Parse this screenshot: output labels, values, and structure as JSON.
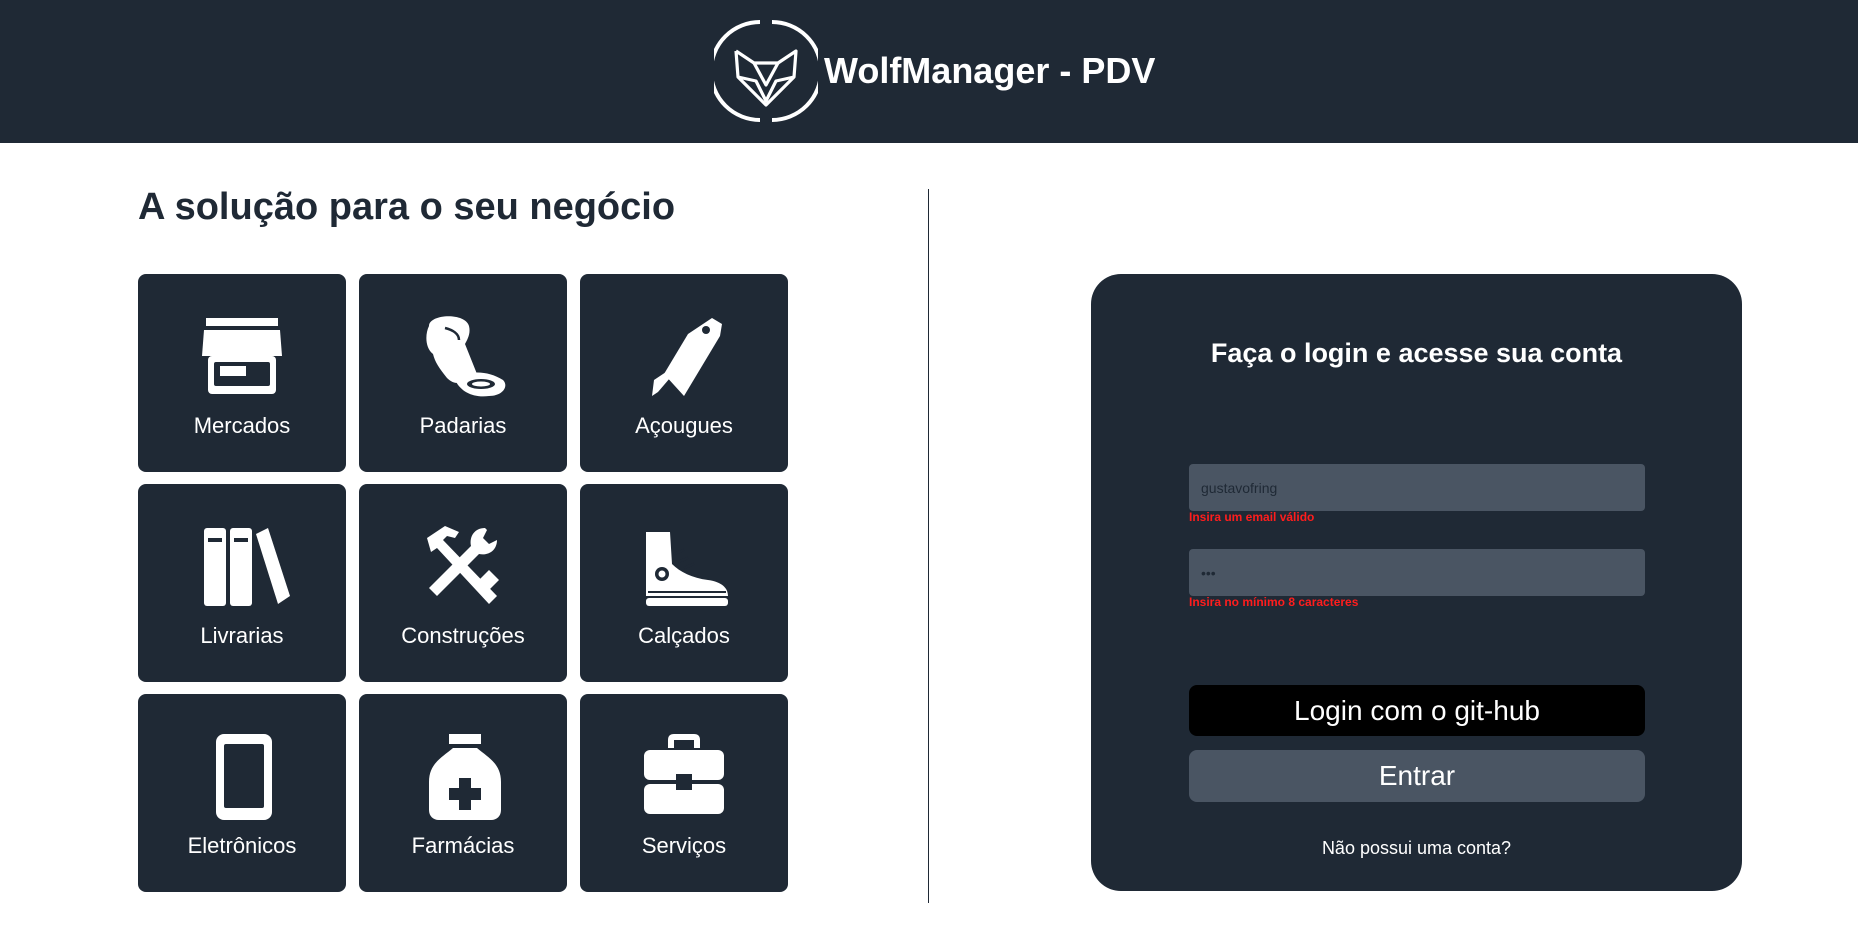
{
  "header": {
    "brand_title": "WolfManager - PDV",
    "logo_icon": "wolf-logo-icon"
  },
  "main": {
    "headline": "A solução para o seu negócio",
    "categories": [
      {
        "label": "Mercados",
        "icon": "store-icon"
      },
      {
        "label": "Padarias",
        "icon": "bread-icon"
      },
      {
        "label": "Açougues",
        "icon": "cleaver-icon"
      },
      {
        "label": "Livrarias",
        "icon": "books-icon"
      },
      {
        "label": "Construções",
        "icon": "tools-icon"
      },
      {
        "label": "Calçados",
        "icon": "sneaker-icon"
      },
      {
        "label": "Eletrônicos",
        "icon": "phone-icon"
      },
      {
        "label": "Farmácias",
        "icon": "medicine-bottle-icon"
      },
      {
        "label": "Serviços",
        "icon": "toolbox-icon"
      }
    ]
  },
  "login": {
    "title": "Faça o login e acesse sua conta",
    "email_value": "gustavofring",
    "email_error": "Insira um email válido",
    "password_value": "•••",
    "password_error": "Insira no mínimo 8 caracteres",
    "github_button": "Login com o git-hub",
    "enter_button": "Entrar",
    "signup_link": "Não possui uma conta?"
  },
  "colors": {
    "dark": "#1f2935",
    "input_bg": "#4a5563",
    "error": "#ff1d1d",
    "github_bg": "#000000",
    "white": "#ffffff"
  }
}
